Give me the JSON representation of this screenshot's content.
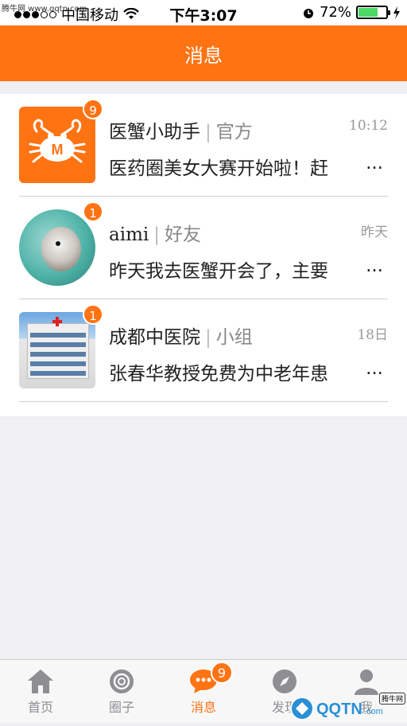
{
  "status_bar": {
    "watermark": "腾牛网 www.qqtn.com",
    "carrier": "中国移动",
    "time": "下午3:07",
    "battery_percent": "72%",
    "battery_level": 0.72
  },
  "nav": {
    "title": "消息"
  },
  "messages": [
    {
      "name": "医蟹小助手",
      "tag": "官方",
      "time": "10:12",
      "preview": "医药圈美女大赛开始啦！赶",
      "badge": "9",
      "avatar": "crab-logo"
    },
    {
      "name": "aimi",
      "tag": "好友",
      "time": "昨天",
      "preview": "昨天我去医蟹开会了，主要",
      "badge": "1",
      "avatar": "hamster-photo"
    },
    {
      "name": "成都中医院",
      "tag": "小组",
      "time": "18日",
      "preview": "张春华教授免费为中老年患",
      "badge": "1",
      "avatar": "hospital-photo"
    }
  ],
  "ellipsis": "...",
  "separator": "|",
  "tabs": [
    {
      "label": "首页",
      "icon": "home-icon"
    },
    {
      "label": "圈子",
      "icon": "circle-icon"
    },
    {
      "label": "消息",
      "icon": "chat-icon",
      "badge": "9",
      "active": true
    },
    {
      "label": "发现",
      "icon": "compass-icon"
    },
    {
      "label": "我",
      "icon": "person-icon"
    }
  ],
  "brand": {
    "text": "QQTN",
    "suffix": ".com",
    "tag": "腾牛网"
  },
  "colors": {
    "accent": "#ff7313",
    "background": "#efeff4",
    "battery": "#4cd964"
  }
}
